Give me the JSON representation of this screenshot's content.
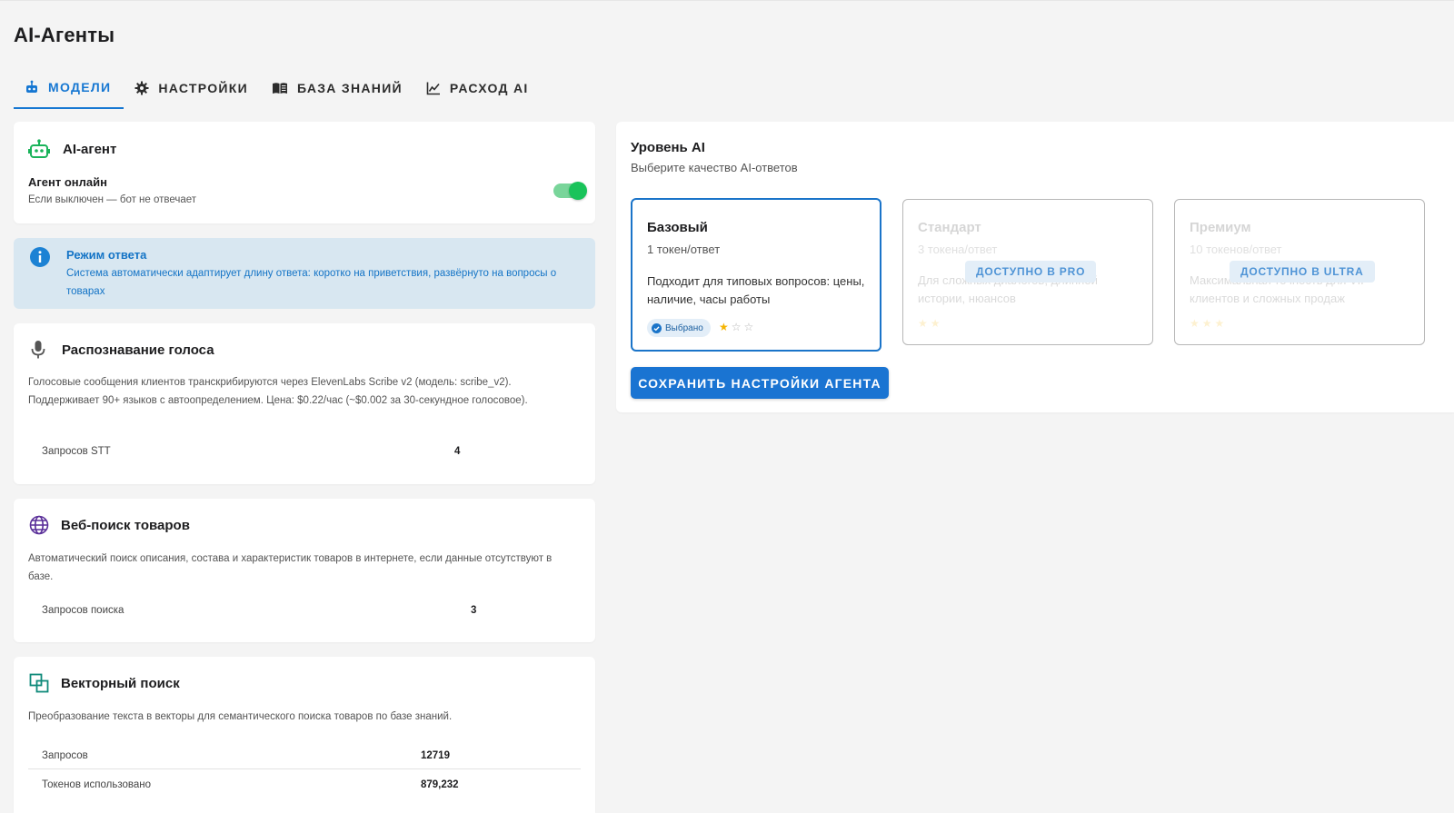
{
  "page": {
    "title": "AI-Агенты"
  },
  "tabs": [
    {
      "label": "МОДЕЛИ",
      "icon": "robot-icon",
      "active": true
    },
    {
      "label": "НАСТРОЙКИ",
      "icon": "gear-icon",
      "active": false
    },
    {
      "label": "БАЗА ЗНАНИЙ",
      "icon": "book-icon",
      "active": false
    },
    {
      "label": "РАСХОД AI",
      "icon": "line-chart-icon",
      "active": false
    }
  ],
  "agent": {
    "title": "AI-агент",
    "status_label": "Агент онлайн",
    "status_hint": "Если выключен — бот не отвечает",
    "online": true
  },
  "response_mode": {
    "title": "Режим ответа",
    "text": "Система автоматически адаптирует длину ответа: коротко на приветствия, развёрнуто на вопросы о товарах"
  },
  "voice": {
    "title": "Распознавание голоса",
    "description": "Голосовые сообщения клиентов транскрибируются через ElevenLabs Scribe v2 (модель: scribe_v2). Поддерживает 90+ языков с автоопределением. Цена: $0.22/час (~$0.002 за 30-секундное голосовое).",
    "stats": [
      {
        "label": "Запросов STT",
        "value": "4"
      }
    ]
  },
  "web_search": {
    "title": "Веб-поиск товаров",
    "description": "Автоматический поиск описания, состава и характеристик товаров в интернете, если данные отсутствуют в базе.",
    "stats": [
      {
        "label": "Запросов поиска",
        "value": "3"
      }
    ]
  },
  "vector_search": {
    "title": "Векторный поиск",
    "description": "Преобразование текста в векторы для семантического поиска товаров по базе знаний.",
    "stats": [
      {
        "label": "Запросов",
        "value": "12719"
      },
      {
        "label": "Токенов использовано",
        "value": "879,232"
      }
    ]
  },
  "level": {
    "title": "Уровень AI",
    "subtitle": "Выберите качество AI-ответов",
    "tiers": [
      {
        "name": "Базовый",
        "cost": "1 токен/ответ",
        "description": "Подходит для типовых вопросов: цены, наличие, часы работы",
        "selected": true,
        "selected_label": "Выбрано",
        "stars": 1,
        "max_stars": 3
      },
      {
        "name": "Стандарт",
        "cost": "3 токена/ответ",
        "description": "Для сложных диалогов, длинной истории, нюансов",
        "selected": false,
        "lock_label": "ДОСТУПНО В PRO",
        "stars": 2
      },
      {
        "name": "Премиум",
        "cost": "10 токенов/ответ",
        "description": "Максимальная точность для VIP-клиентов и сложных продаж",
        "selected": false,
        "lock_label": "ДОСТУПНО В ULTRA",
        "stars": 3
      }
    ],
    "save_label": "СОХРАНИТЬ НАСТРОЙКИ АГЕНТА"
  },
  "colors": {
    "accent": "#1677d2",
    "toggle_on": "#19c35a",
    "info_bg": "#d8e7f1",
    "star": "#f5b400"
  }
}
